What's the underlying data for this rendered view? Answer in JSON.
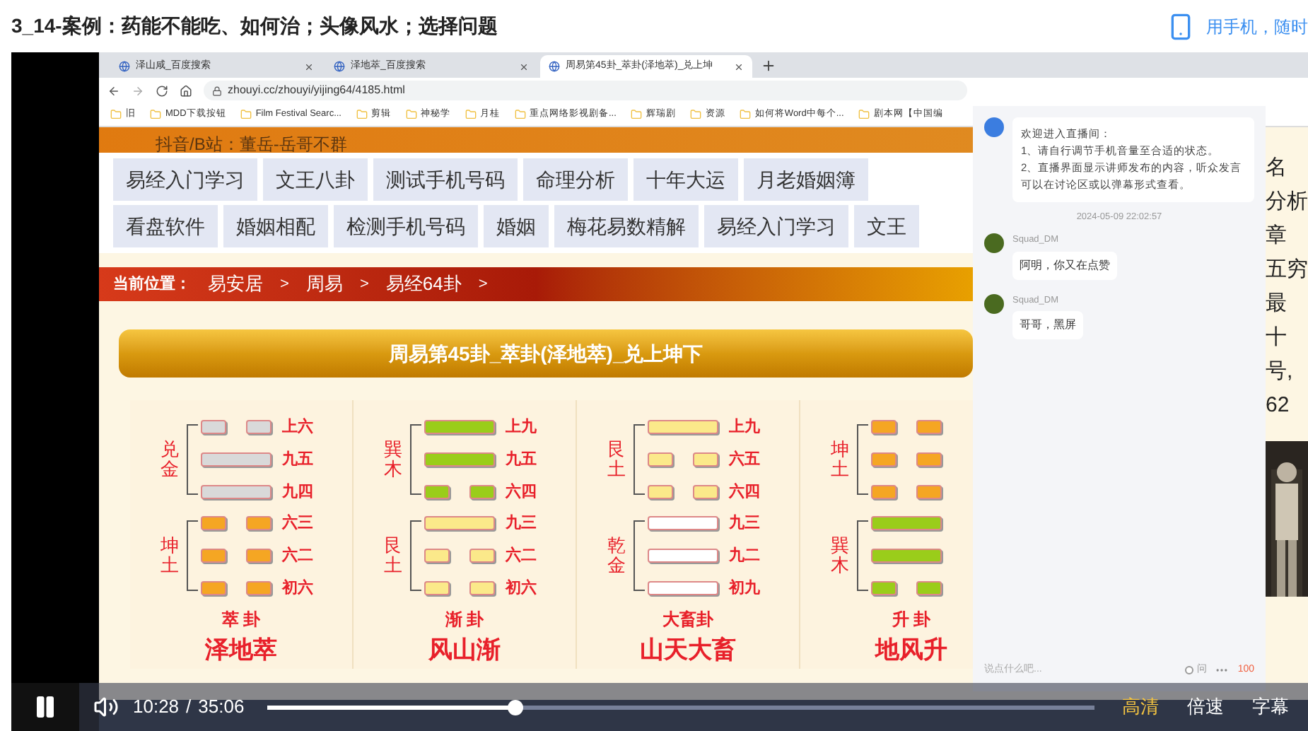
{
  "header": {
    "title": "3_14-案例：药能不能吃、如何治；头像风水；选择问题",
    "mobile_link": "用手机，随时"
  },
  "browser": {
    "tabs": [
      {
        "label": "泽山咸_百度搜索",
        "selected": false
      },
      {
        "label": "泽地萃_百度搜索",
        "selected": false
      },
      {
        "label": "周易第45卦_萃卦(泽地萃)_兑上坤",
        "selected": true
      }
    ],
    "url": "zhouyi.cc/zhouyi/yijing64/4185.html",
    "bookmarks": [
      "旧",
      "MDD下载按钮",
      "Film Festival Searc...",
      "剪辑",
      "神秘学",
      "月桂",
      "重点网络影视剧备...",
      "辉瑞剧",
      "资源",
      "如何将Word中每个...",
      "剧本网【中国编"
    ]
  },
  "page": {
    "top_note": "抖音/B站：董岳-岳哥不群",
    "nav_rows": [
      [
        "易经入门学习",
        "文王八卦",
        "测试手机号码",
        "命理分析",
        "十年大运",
        "月老婚姻簿"
      ],
      [
        "看盘软件",
        "婚姻相配",
        "检测手机号码",
        "婚姻",
        "梅花易数精解",
        "易经入门学习",
        "文王"
      ]
    ],
    "breadcrumb": {
      "label": "当前位置：",
      "items": [
        "易安居",
        "周易",
        "易经64卦"
      ],
      "separator": ">"
    },
    "banner": "周易第45卦_萃卦(泽地萃)_兑上坤下",
    "hexagrams": [
      {
        "trigrams": [
          {
            "label": "兑金",
            "color": "#d9d9d9",
            "lines": [
              {
                "kind": "yin",
                "label": "上六"
              },
              {
                "kind": "yang",
                "label": "九五"
              },
              {
                "kind": "yang",
                "label": "九四"
              }
            ]
          },
          {
            "label": "坤土",
            "color": "#f5a623",
            "lines": [
              {
                "kind": "yin",
                "label": "六三"
              },
              {
                "kind": "yin",
                "label": "六二"
              },
              {
                "kind": "yin",
                "label": "初六"
              }
            ]
          }
        ],
        "short_name": "萃 卦",
        "name": "泽地萃"
      },
      {
        "trigrams": [
          {
            "label": "巽木",
            "color": "#9acd1a",
            "lines": [
              {
                "kind": "yang",
                "label": "上九"
              },
              {
                "kind": "yang",
                "label": "九五"
              },
              {
                "kind": "yin",
                "label": "六四"
              }
            ]
          },
          {
            "label": "艮土",
            "color": "#fbe98a",
            "lines": [
              {
                "kind": "yang",
                "label": "九三"
              },
              {
                "kind": "yin",
                "label": "六二"
              },
              {
                "kind": "yin",
                "label": "初六"
              }
            ]
          }
        ],
        "short_name": "渐 卦",
        "name": "风山渐"
      },
      {
        "trigrams": [
          {
            "label": "艮土",
            "color": "#fbe98a",
            "lines": [
              {
                "kind": "yang",
                "label": "上九"
              },
              {
                "kind": "yin",
                "label": "六五"
              },
              {
                "kind": "yin",
                "label": "六四"
              }
            ]
          },
          {
            "label": "乾金",
            "color": "#ffffff",
            "lines": [
              {
                "kind": "yang",
                "label": "九三"
              },
              {
                "kind": "yang",
                "label": "九二"
              },
              {
                "kind": "yang",
                "label": "初九"
              }
            ]
          }
        ],
        "short_name": "大畜卦",
        "name": "山天大畜"
      },
      {
        "trigrams": [
          {
            "label": "坤土",
            "color": "#f5a623",
            "lines": [
              {
                "kind": "yin"
              },
              {
                "kind": "yin"
              },
              {
                "kind": "yin"
              }
            ]
          },
          {
            "label": "巽木",
            "color": "#9acd1a",
            "lines": [
              {
                "kind": "yang"
              },
              {
                "kind": "yang"
              },
              {
                "kind": "yin"
              }
            ]
          }
        ],
        "short_name": "升 卦",
        "name": "地风升"
      }
    ],
    "right_fragments": [
      "名",
      "分析",
      "章",
      "五穷",
      "最",
      "十",
      "号,",
      "62"
    ]
  },
  "chat": {
    "welcome": [
      "欢迎进入直播间：",
      "1、请自行调节手机音量至合适的状态。",
      "2、直播界面显示讲师发布的内容，听众发言可以在讨论区或以弹幕形式查看。"
    ],
    "timestamp": "2024-05-09 22:02:57",
    "messages": [
      {
        "user": "Squad_DM",
        "text": "阿明，你又在点赞"
      },
      {
        "user": "Squad_DM",
        "text": "哥哥，黑屏"
      }
    ],
    "input": {
      "placeholder": "说点什么吧..."
    },
    "ask": {
      "label": "问",
      "checked": false
    },
    "like_count": "100"
  },
  "player": {
    "playing": true,
    "current_time": "10:28",
    "time_separator": "/",
    "duration": "35:06",
    "progress": {
      "level": 0.3
    },
    "options": [
      {
        "label": "高清",
        "selected": true
      },
      {
        "label": "倍速",
        "selected": false
      },
      {
        "label": "字幕",
        "selected": false
      }
    ]
  }
}
